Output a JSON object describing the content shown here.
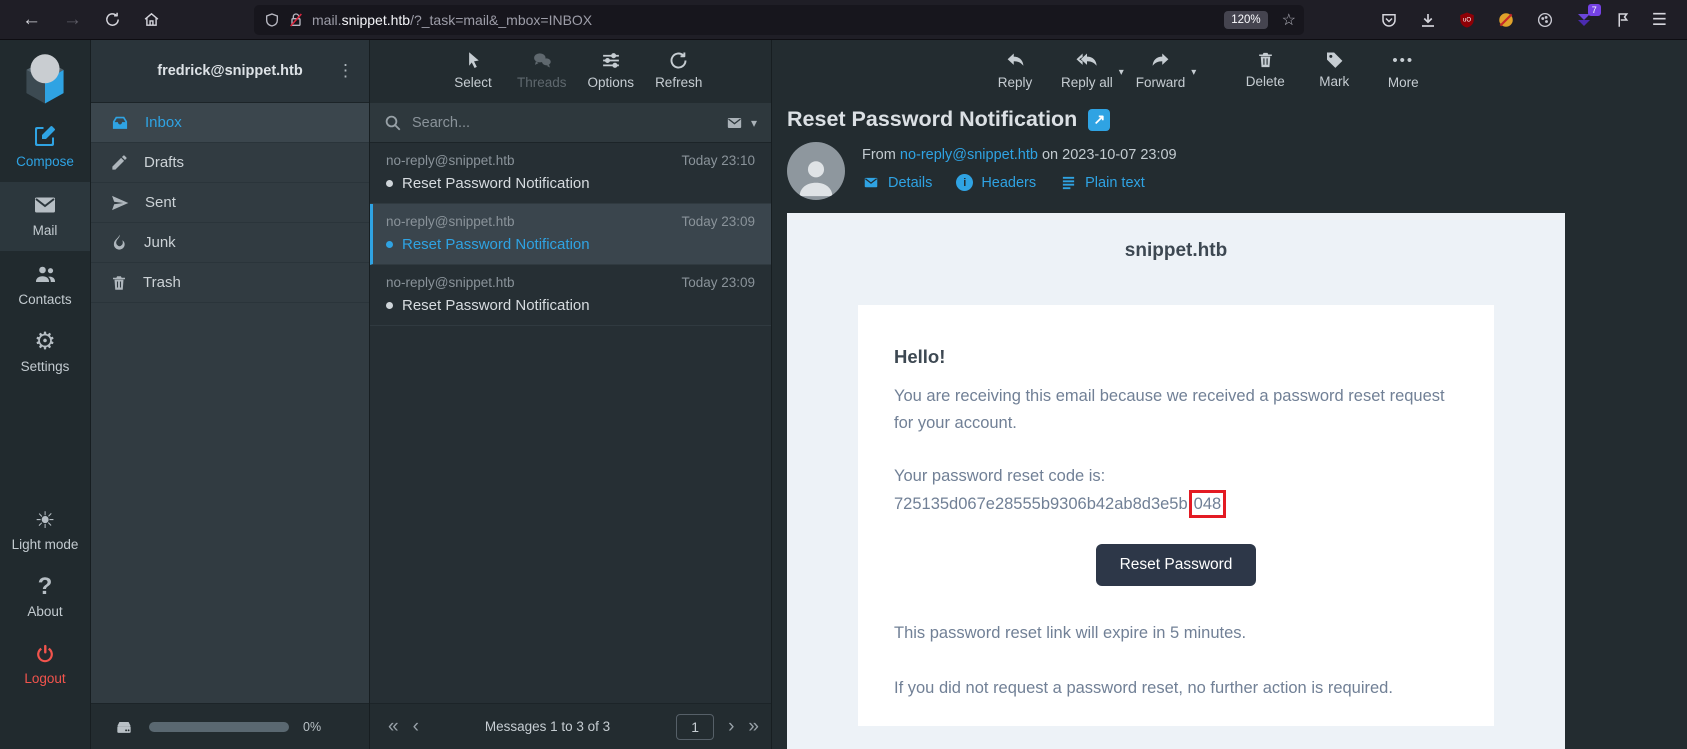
{
  "browser": {
    "url_prefix": "mail.",
    "url_domain": "snippet.htb",
    "url_path": "/?_task=mail&_mbox=INBOX",
    "zoom_badge": "120%",
    "ext_badge": "7"
  },
  "icons": {
    "back": "←",
    "forward": "→",
    "star": "☆",
    "menu": "☰",
    "kebab": "⋮",
    "caret": "▾",
    "chevron_down": "▾",
    "more": "•••",
    "page_first": "«",
    "page_prev": "‹",
    "page_next": "›",
    "page_last": "»",
    "external_link": "↗",
    "question": "?",
    "gear": "⚙",
    "sun": "☀",
    "info": "i"
  },
  "sidebar": {
    "compose": "Compose",
    "mail": "Mail",
    "contacts": "Contacts",
    "settings": "Settings",
    "light_mode": "Light mode",
    "about": "About",
    "logout": "Logout"
  },
  "folders": {
    "account": "fredrick@snippet.htb",
    "inbox": "Inbox",
    "drafts": "Drafts",
    "sent": "Sent",
    "junk": "Junk",
    "trash": "Trash",
    "quota": "0%"
  },
  "list": {
    "toolbar": {
      "select": "Select",
      "threads": "Threads",
      "options": "Options",
      "refresh": "Refresh"
    },
    "search_placeholder": "Search...",
    "messages": [
      {
        "sender": "no-reply@snippet.htb",
        "time": "Today 23:10",
        "subject": "Reset Password Notification"
      },
      {
        "sender": "no-reply@snippet.htb",
        "time": "Today 23:09",
        "subject": "Reset Password Notification"
      },
      {
        "sender": "no-reply@snippet.htb",
        "time": "Today 23:09",
        "subject": "Reset Password Notification"
      }
    ],
    "pagination": {
      "summary": "Messages 1 to 3 of 3",
      "page": "1"
    }
  },
  "message": {
    "toolbar": {
      "reply": "Reply",
      "reply_all": "Reply all",
      "forward": "Forward",
      "delete": "Delete",
      "mark": "Mark",
      "more": "More"
    },
    "subject": "Reset Password Notification",
    "from_label": "From",
    "from_address": "no-reply@snippet.htb",
    "date_label": "on",
    "date": "2023-10-07 23:09",
    "actions": {
      "details": "Details",
      "headers": "Headers",
      "plain_text": "Plain text"
    },
    "email": {
      "brand": "snippet.htb",
      "greeting": "Hello!",
      "intro": "You are receiving this email because we received a password reset request for your account.",
      "code_label": "Your password reset code is:",
      "code_prefix": "725135d067e28555b9306b42ab8d3e5b",
      "code_highlight": "048",
      "button": "Reset Password",
      "expiry": "This password reset link will expire in 5 minutes.",
      "footer": "If you did not request a password reset, no further action is required."
    }
  },
  "colors": {
    "accent": "#2fa3e3",
    "danger": "#f2544d",
    "email_bg": "#edf2f7",
    "email_text": "#718096",
    "email_heading": "#3d4852",
    "email_button": "#2d3748",
    "highlight_border": "#e31b23"
  }
}
